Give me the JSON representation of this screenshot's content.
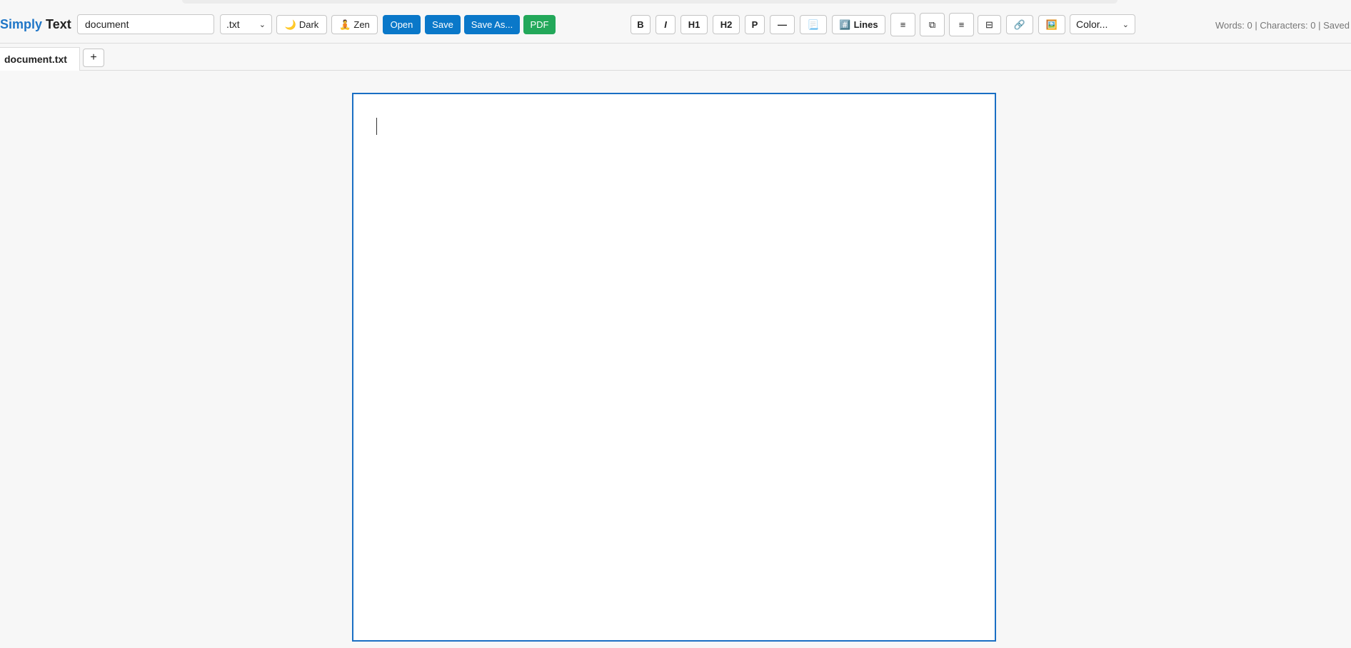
{
  "app": {
    "brand_part1": "Simply",
    "brand_part2": "Text"
  },
  "toolbar": {
    "filename_value": "document",
    "extension_selected": ".txt",
    "dark_label": "Dark",
    "dark_icon": "🌙",
    "zen_label": "Zen",
    "zen_icon": "🧘",
    "open_label": "Open",
    "save_label": "Save",
    "save_as_label": "Save As...",
    "pdf_label": "PDF"
  },
  "format": {
    "bold": "B",
    "italic": "I",
    "h1": "H1",
    "h2": "H2",
    "p": "P",
    "hr": "—",
    "page_icon": "📃",
    "lines_icon": "#️⃣",
    "lines_label": "Lines",
    "align_left": "≡",
    "copy_icon": "⧉",
    "align_center": "≡",
    "table_icon": "⊟",
    "link_icon": "🔗",
    "image_icon": "🖼️",
    "color_selected": "Color..."
  },
  "status": {
    "words_label": "Words:",
    "words": "0",
    "chars_label": "Characters:",
    "chars": "0",
    "save_state": "Saved"
  },
  "tabs": [
    {
      "label": "document.txt"
    }
  ],
  "tab_add_label": "+"
}
